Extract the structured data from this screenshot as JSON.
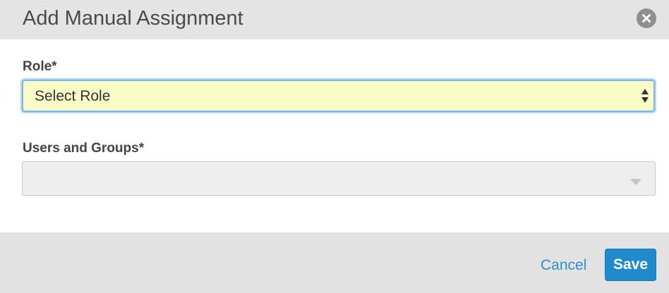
{
  "dialog": {
    "title": "Add Manual Assignment",
    "close_icon": "close-circle-icon"
  },
  "form": {
    "role": {
      "label": "Role*",
      "selected_value": "Select Role",
      "arrow_icon": "select-up-down-arrows-icon",
      "focused": true,
      "background_color": "#fafcc8"
    },
    "users_and_groups": {
      "label": "Users and Groups*",
      "value": "",
      "arrow_icon": "chevron-down-icon",
      "disabled": true
    }
  },
  "footer": {
    "cancel_label": "Cancel",
    "save_label": "Save"
  },
  "colors": {
    "header_bg": "#e4e4e4",
    "footer_bg": "#e2e2e2",
    "primary": "#1f8bcc",
    "link": "#2e8fc9",
    "focus_ring": "#7cb4ee"
  }
}
